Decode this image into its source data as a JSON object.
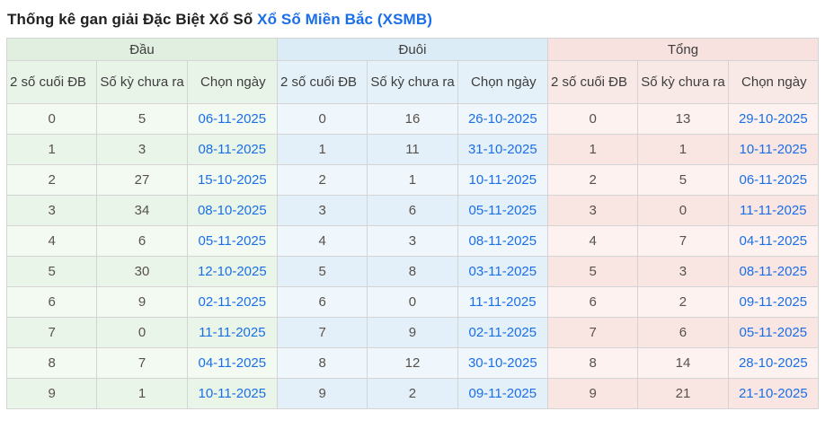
{
  "title": {
    "prefix": "Thống kê gan giải Đặc Biệt Xổ Số ",
    "link_text": "Xổ Số Miền Bắc (XSMB)"
  },
  "colors": {
    "link_blue": "#1a6fe8",
    "title_text": "#212121",
    "number_text": "#57514b",
    "header_text": "#3d3d3d",
    "border": "#d4d4d4",
    "dau_header": "#e0efdf",
    "dau_sub": "#e9f4e8",
    "dau_row_light": "#f3faf2",
    "dau_row_dark": "#eaf5e9",
    "duoi_header": "#dcecf6",
    "duoi_sub": "#e4f1f9",
    "duoi_row_light": "#eff7fc",
    "duoi_row_dark": "#e4f0f9",
    "tong_header": "#f7e2e0",
    "tong_sub": "#f9e9e6",
    "tong_row_light": "#fdf2f0",
    "tong_row_dark": "#f9e5e2"
  },
  "table": {
    "groups": [
      {
        "key": "dau",
        "label": "Đầu"
      },
      {
        "key": "duoi",
        "label": "Đuôi"
      },
      {
        "key": "tong",
        "label": "Tổng"
      }
    ],
    "column_headers": [
      "2 số cuối ĐB",
      "Số kỳ chưa ra",
      "Chọn ngày"
    ],
    "rows": [
      {
        "dau": [
          "0",
          "5",
          "06-11-2025"
        ],
        "duoi": [
          "0",
          "16",
          "26-10-2025"
        ],
        "tong": [
          "0",
          "13",
          "29-10-2025"
        ]
      },
      {
        "dau": [
          "1",
          "3",
          "08-11-2025"
        ],
        "duoi": [
          "1",
          "11",
          "31-10-2025"
        ],
        "tong": [
          "1",
          "1",
          "10-11-2025"
        ]
      },
      {
        "dau": [
          "2",
          "27",
          "15-10-2025"
        ],
        "duoi": [
          "2",
          "1",
          "10-11-2025"
        ],
        "tong": [
          "2",
          "5",
          "06-11-2025"
        ]
      },
      {
        "dau": [
          "3",
          "34",
          "08-10-2025"
        ],
        "duoi": [
          "3",
          "6",
          "05-11-2025"
        ],
        "tong": [
          "3",
          "0",
          "11-11-2025"
        ]
      },
      {
        "dau": [
          "4",
          "6",
          "05-11-2025"
        ],
        "duoi": [
          "4",
          "3",
          "08-11-2025"
        ],
        "tong": [
          "4",
          "7",
          "04-11-2025"
        ]
      },
      {
        "dau": [
          "5",
          "30",
          "12-10-2025"
        ],
        "duoi": [
          "5",
          "8",
          "03-11-2025"
        ],
        "tong": [
          "5",
          "3",
          "08-11-2025"
        ]
      },
      {
        "dau": [
          "6",
          "9",
          "02-11-2025"
        ],
        "duoi": [
          "6",
          "0",
          "11-11-2025"
        ],
        "tong": [
          "6",
          "2",
          "09-11-2025"
        ]
      },
      {
        "dau": [
          "7",
          "0",
          "11-11-2025"
        ],
        "duoi": [
          "7",
          "9",
          "02-11-2025"
        ],
        "tong": [
          "7",
          "6",
          "05-11-2025"
        ]
      },
      {
        "dau": [
          "8",
          "7",
          "04-11-2025"
        ],
        "duoi": [
          "8",
          "12",
          "30-10-2025"
        ],
        "tong": [
          "8",
          "14",
          "28-10-2025"
        ]
      },
      {
        "dau": [
          "9",
          "1",
          "10-11-2025"
        ],
        "duoi": [
          "9",
          "2",
          "09-11-2025"
        ],
        "tong": [
          "9",
          "21",
          "21-10-2025"
        ]
      }
    ]
  }
}
